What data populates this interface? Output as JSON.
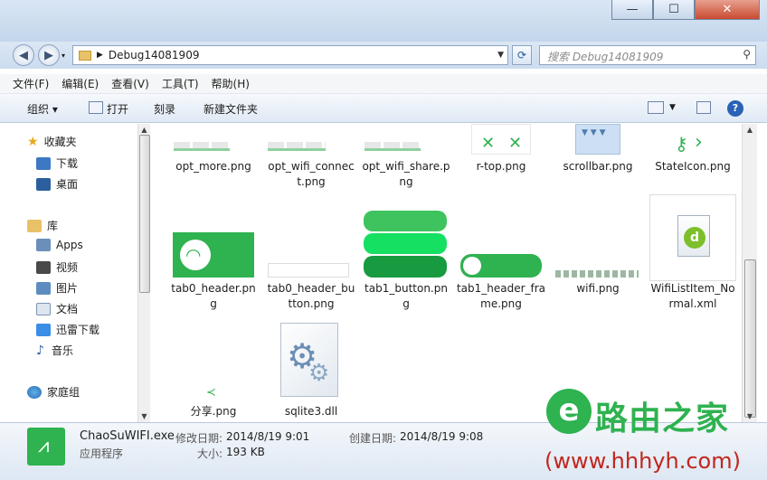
{
  "window": {
    "minimize": "—",
    "maximize": "☐",
    "close": "✕"
  },
  "address": {
    "path": "Debug14081909",
    "search_placeholder": "搜索 Debug14081909"
  },
  "menu": [
    "文件(F)",
    "编辑(E)",
    "查看(V)",
    "工具(T)",
    "帮助(H)"
  ],
  "toolbar": {
    "organize": "组织 ▾",
    "open": "打开",
    "burn": "刻录",
    "new_folder": "新建文件夹"
  },
  "sidebar": {
    "favorites": "收藏夹",
    "downloads": "下载",
    "desktop": "桌面",
    "libraries": "库",
    "apps": "Apps",
    "videos": "视频",
    "pictures": "图片",
    "documents": "文档",
    "thunder": "迅雷下载",
    "music": "音乐",
    "homegroup": "家庭组"
  },
  "files": [
    {
      "name1": "opt_more.png",
      "name2": ""
    },
    {
      "name1": "opt_wifi_connec",
      "name2": "t.png"
    },
    {
      "name1": "opt_wifi_share.p",
      "name2": "ng"
    },
    {
      "name1": "r-top.png",
      "name2": ""
    },
    {
      "name1": "scrollbar.png",
      "name2": ""
    },
    {
      "name1": "StateIcon.png",
      "name2": ""
    },
    {
      "name1": "tab0_header.pn",
      "name2": "g"
    },
    {
      "name1": "tab0_header_bu",
      "name2": "tton.png"
    },
    {
      "name1": "tab1_button.pn",
      "name2": "g"
    },
    {
      "name1": "tab1_header_fra",
      "name2": "me.png"
    },
    {
      "name1": "wifi.png",
      "name2": ""
    },
    {
      "name1": "WifiListItem_No",
      "name2": "rmal.xml"
    },
    {
      "name1": "分享.png",
      "name2": ""
    },
    {
      "name1": "sqlite3.dll",
      "name2": ""
    }
  ],
  "details": {
    "filename": "ChaoSuWIFI.exe",
    "type": "应用程序",
    "modified_label": "修改日期:",
    "modified_value": "2014/8/19 9:01",
    "created_label": "创建日期:",
    "created_value": "2014/8/19 9:08",
    "size_label": "大小:",
    "size_value": "193 KB"
  },
  "watermark": {
    "brand": "路由之家",
    "url": "(www.hhhyh.com)"
  },
  "colors": {
    "wifi_green": "#2fb250",
    "accent_blue": "#1f4f8f"
  }
}
